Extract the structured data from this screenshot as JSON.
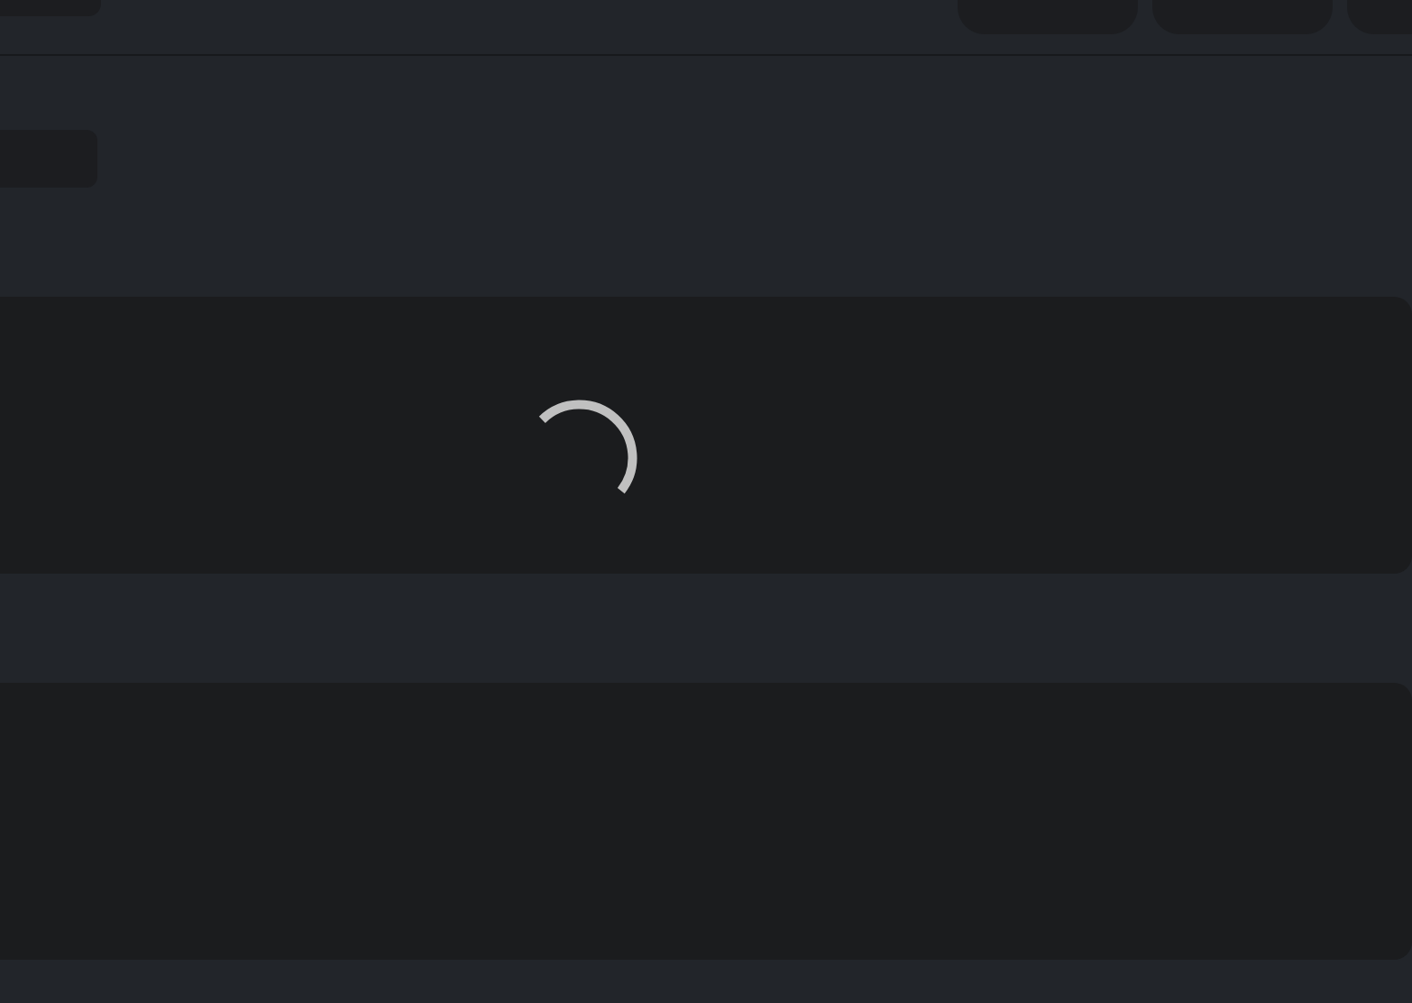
{
  "cards": [
    {
      "loading": true
    },
    {
      "loading": false
    }
  ]
}
